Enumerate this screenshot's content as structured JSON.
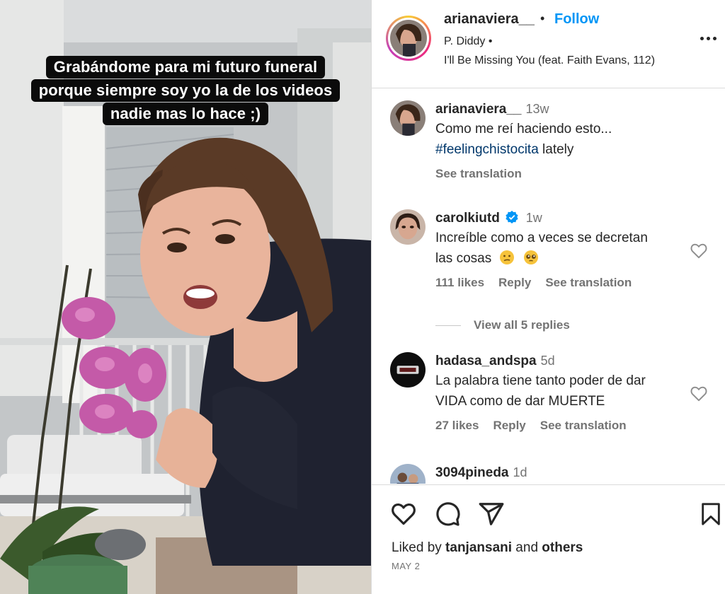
{
  "media": {
    "caption_lines": [
      "Grabándome para mi futuro funeral",
      "porque siempre soy yo la de los videos",
      "nadie mas lo hace ;)"
    ]
  },
  "header": {
    "username": "arianaviera__",
    "separator": "•",
    "follow_label": "Follow",
    "artist": "P. Diddy •",
    "song": "I'll Be Missing You (feat. Faith Evans, 112)"
  },
  "comments": [
    {
      "username": "arianaviera__",
      "time": "13w",
      "text_line1": "Como me reí haciendo esto...",
      "hashtag": "#feelingchistocita",
      "text_after_tag": " lately",
      "see_translation": "See translation"
    },
    {
      "username": "carolkiutd",
      "verified": true,
      "time": "1w",
      "text_line1": "Increíble como a veces se decretan",
      "text_line2": "las cosas",
      "likes": "111 likes",
      "reply": "Reply",
      "see_translation": "See translation",
      "view_replies": "View all 5 replies"
    },
    {
      "username": "hadasa_andspa",
      "time": "5d",
      "text_line1": "La palabra tiene tanto poder de dar",
      "text_line2": "VIDA como de dar MUERTE",
      "likes": "27 likes",
      "reply": "Reply",
      "see_translation": "See translation"
    },
    {
      "username": "3094pineda",
      "time": "1d"
    }
  ],
  "footer": {
    "liked_by_prefix": "Liked by ",
    "liked_by_user": "tanjansani",
    "liked_by_and": " and ",
    "liked_by_others": "others",
    "date": "MAY 2"
  },
  "colors": {
    "accent_blue": "#0095f6",
    "hashtag_blue": "#00376b",
    "muted_text": "#737373",
    "text": "#262626",
    "divider": "#dbdbdb"
  },
  "icons": [
    "more-icon",
    "heart-icon",
    "comment-icon",
    "share-icon",
    "bookmark-icon",
    "verified-badge-icon"
  ]
}
